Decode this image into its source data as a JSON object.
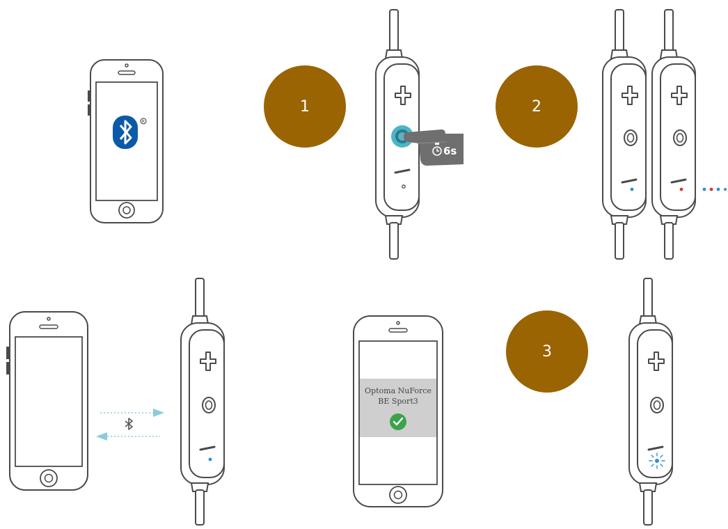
{
  "steps": [
    {
      "number": "1"
    },
    {
      "number": "2"
    },
    {
      "number": "3"
    }
  ],
  "remote": {
    "hold_time_label": "6s"
  },
  "phone_pairing": {
    "device_name_line1": "Optoma NuForce",
    "device_name_line2": "BE Sport3",
    "confirm_icon": "check-icon"
  },
  "colors": {
    "step_circle": "#9a6402",
    "bluetooth_blue": "#0b5aa8",
    "led_blue": "#2f8fd0",
    "led_red": "#d23a3a",
    "pairing_arrow": "#8ccbd8",
    "confirm_green": "#3aa34a",
    "screen_highlight": "#cfcfcf"
  },
  "icons": [
    "bluetooth-icon",
    "clock-icon",
    "hand-press-icon",
    "led-flash-icon",
    "plus-icon",
    "minus-icon",
    "home-button-icon"
  ]
}
